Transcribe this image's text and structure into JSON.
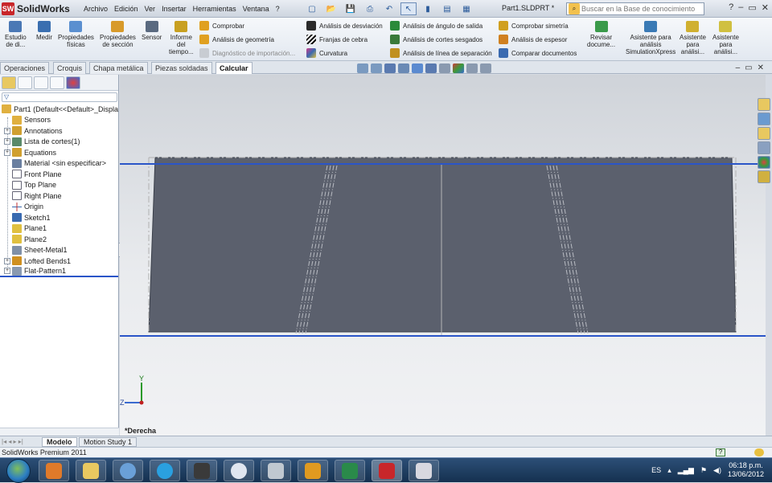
{
  "app": {
    "logo_text": "SolidWorks",
    "doc_title": "Part1.SLDPRT *"
  },
  "menu": [
    "Archivo",
    "Edición",
    "Ver",
    "Insertar",
    "Herramientas",
    "Ventana",
    "?"
  ],
  "search": {
    "placeholder": "Buscar en la Base de conocimiento",
    "help": "?"
  },
  "ribbon": {
    "big_buttons": [
      {
        "label": "Estudio\nde di...",
        "icon": "study-icon",
        "color": "#4a78b5"
      },
      {
        "label": "Medir",
        "icon": "measure-icon",
        "color": "#3a6fb0"
      },
      {
        "label": "Propiedades\nfísicas",
        "icon": "mass-properties-icon",
        "color": "#5a8fd0"
      },
      {
        "label": "Propiedades\nde sección",
        "icon": "section-properties-icon",
        "color": "#d89a2a"
      },
      {
        "label": "Sensor",
        "icon": "sensor-icon",
        "color": "#5a6a80"
      },
      {
        "label": "Informe\ndel\ntiempo...",
        "icon": "report-icon",
        "color": "#c8a020"
      },
      {
        "label": "Revisar\ndocume...",
        "icon": "check-document-icon",
        "color": "#3a9a4a"
      },
      {
        "label": "Asistente para\nanálisis\nSimulationXpress",
        "icon": "simulation-icon",
        "color": "#3a7ab5"
      },
      {
        "label": "Asistente\npara\nanálisi...",
        "icon": "floxpress-icon",
        "color": "#d0b030"
      },
      {
        "label": "Asistente\npara\nanálisi...",
        "icon": "drwcompare-icon",
        "color": "#d0c040"
      }
    ],
    "check_col": [
      {
        "label": "Comprobar",
        "icon": "check-icon",
        "color": "#e0a020"
      },
      {
        "label": "Análisis de geometría",
        "icon": "geometry-analysis-icon",
        "color": "#e0a020"
      },
      {
        "label": "Diagnóstico de importación...",
        "icon": "import-diagnostics-icon",
        "color": "#9aa0a8"
      }
    ],
    "analysis_col1": [
      {
        "label": "Análisis de desviación",
        "icon": "deviation-icon",
        "color": "#2a2a2a"
      },
      {
        "label": "Franjas de cebra",
        "icon": "zebra-icon",
        "color": "#111111"
      },
      {
        "label": "Curvatura",
        "icon": "curvature-icon",
        "color": "#d03a8a"
      }
    ],
    "analysis_col2": [
      {
        "label": "Análisis de ángulo de salida",
        "icon": "draft-icon",
        "color": "#2a8a3a"
      },
      {
        "label": "Análisis de cortes sesgados",
        "icon": "undercut-icon",
        "color": "#3a7a3a"
      },
      {
        "label": "Análisis de línea de separación",
        "icon": "parting-line-icon",
        "color": "#c09020"
      }
    ],
    "analysis_col3": [
      {
        "label": "Comprobar simetría",
        "icon": "symmetry-icon",
        "color": "#d0a020"
      },
      {
        "label": "Análisis de espesor",
        "icon": "thickness-icon",
        "color": "#d08020"
      },
      {
        "label": "Comparar documentos",
        "icon": "compare-icon",
        "color": "#3a6ab0"
      }
    ]
  },
  "tabs": [
    {
      "label": "Operaciones",
      "active": false
    },
    {
      "label": "Croquis",
      "active": false
    },
    {
      "label": "Chapa metálica",
      "active": false
    },
    {
      "label": "Piezas soldadas",
      "active": false
    },
    {
      "label": "Calcular",
      "active": true
    }
  ],
  "tree": {
    "root": "Part1  (Default<<Default>_Displa",
    "items": [
      {
        "label": "Sensors",
        "expand": false,
        "icon": "sensor-folder-icon",
        "color": "#e0b040"
      },
      {
        "label": "Annotations",
        "expand": true,
        "icon": "annotations-icon",
        "color": "#d0a030"
      },
      {
        "label": "Lista de cortes(1)",
        "expand": true,
        "icon": "cut-list-icon",
        "color": "#5a8a6a"
      },
      {
        "label": "Equations",
        "expand": true,
        "icon": "equations-icon",
        "color": "#d0a030"
      },
      {
        "label": "Material <sin especificar>",
        "expand": false,
        "icon": "material-icon",
        "color": "#6a7fa0"
      },
      {
        "label": "Front Plane",
        "expand": false,
        "icon": "plane-icon",
        "color": "#ffffff"
      },
      {
        "label": "Top Plane",
        "expand": false,
        "icon": "plane-icon",
        "color": "#ffffff"
      },
      {
        "label": "Right Plane",
        "expand": false,
        "icon": "plane-icon",
        "color": "#ffffff"
      },
      {
        "label": "Origin",
        "expand": false,
        "icon": "origin-icon",
        "color": "#c03030"
      },
      {
        "label": "Sketch1",
        "expand": false,
        "icon": "sketch-icon",
        "color": "#3a6ab0"
      },
      {
        "label": "Plane1",
        "expand": false,
        "icon": "plane-yellow-icon",
        "color": "#e0c040"
      },
      {
        "label": "Plane2",
        "expand": false,
        "icon": "plane-yellow-icon",
        "color": "#e0c040"
      },
      {
        "label": "Sheet-Metal1",
        "expand": false,
        "icon": "sheet-metal-icon",
        "color": "#8090a8"
      },
      {
        "label": "Lofted Bends1",
        "expand": true,
        "icon": "lofted-bends-icon",
        "color": "#d09020"
      },
      {
        "label": "Flat-Pattern1",
        "expand": true,
        "icon": "flat-pattern-icon",
        "color": "#8a9ab0"
      }
    ]
  },
  "viewport": {
    "view_label": "*Derecha",
    "axis_y": "Y",
    "axis_z": "Z"
  },
  "bottom_tabs": [
    {
      "label": "Modelo",
      "active": true
    },
    {
      "label": "Motion Study 1",
      "active": false
    }
  ],
  "status_text": "SolidWorks Premium 2011",
  "taskbar": {
    "apps": [
      {
        "name": "firefox",
        "color": "#e07a2a"
      },
      {
        "name": "explorer",
        "color": "#e8c860"
      },
      {
        "name": "itunes",
        "color": "#6aa0d8"
      },
      {
        "name": "skype",
        "color": "#2aa0e0"
      },
      {
        "name": "media",
        "color": "#3a3a3a"
      },
      {
        "name": "search",
        "color": "#e0e6f0"
      },
      {
        "name": "calculator",
        "color": "#c0c8d0"
      },
      {
        "name": "outlook",
        "color": "#e09a20"
      },
      {
        "name": "excel",
        "color": "#2a8a4a"
      },
      {
        "name": "solidworks",
        "color": "#c8262a"
      },
      {
        "name": "paint",
        "color": "#d8d8e0"
      }
    ],
    "lang": "ES",
    "time": "06:18 p.m.",
    "date": "13/06/2012"
  },
  "colors": {
    "part_fill": "#5b606d",
    "part_edge": "#3a3f4a",
    "blue_line": "#2a55c8",
    "centerline": "#b5b5b5"
  }
}
